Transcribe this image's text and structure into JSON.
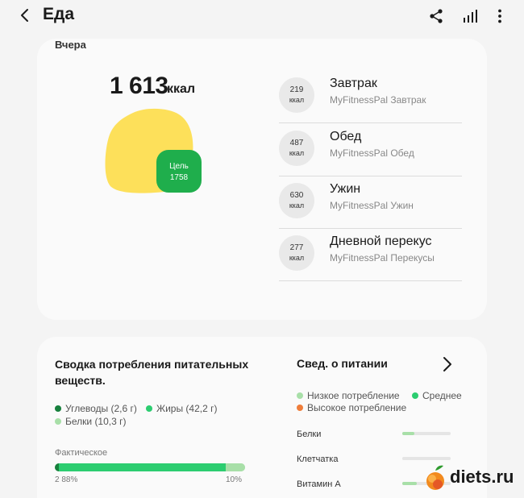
{
  "header": {
    "title": "Еда",
    "icons": [
      "back-icon",
      "share-icon",
      "stats-icon",
      "more-icon"
    ]
  },
  "day_card": {
    "section_label": "Вчера",
    "total_kcal": "1 613",
    "kcal_unit": "ккал",
    "goal_label": "Цель",
    "goal_value": "1758",
    "consumed_fraction": 0.92,
    "meals": [
      {
        "kcal": "219",
        "unit": "ккал",
        "name": "Завтрак",
        "source": "MyFitnessPal Завтрак"
      },
      {
        "kcal": "487",
        "unit": "ккал",
        "name": "Обед",
        "source": "MyFitnessPal Обед"
      },
      {
        "kcal": "630",
        "unit": "ккал",
        "name": "Ужин",
        "source": "MyFitnessPal Ужин"
      },
      {
        "kcal": "277",
        "unit": "ккал",
        "name": "Дневной перекус",
        "source": "MyFitnessPal Перекусы"
      }
    ]
  },
  "summary_card": {
    "title": "Сводка потребления питательных веществ.",
    "legend": [
      {
        "label": "Углеводы (2,6 г)",
        "color": "#17803d"
      },
      {
        "label": "Жиры (42,2 г)",
        "color": "#2ccd70"
      },
      {
        "label": "Белки (10,3 г)",
        "color": "#a8dfa8"
      }
    ],
    "actual_label": "Фактическое",
    "bar_left": "2 88%",
    "bar_right": "10%",
    "bar_fractions": [
      0.02,
      0.88,
      0.1
    ],
    "nutrition_title": "Свед. о питании",
    "levels": [
      {
        "label": "Низкое потребление",
        "color": "#a8dfa8"
      },
      {
        "label": "Среднее",
        "color": "#2ccd70"
      },
      {
        "label": "Высокое потребление",
        "color": "#ef7d3a"
      }
    ],
    "nutrients": [
      {
        "name": "Белки",
        "fraction": 0.25
      },
      {
        "name": "Клетчатка",
        "fraction": 0.0
      },
      {
        "name": "Витамин А",
        "fraction": 0.3
      }
    ]
  },
  "watermark": {
    "text": "diets.ru"
  }
}
